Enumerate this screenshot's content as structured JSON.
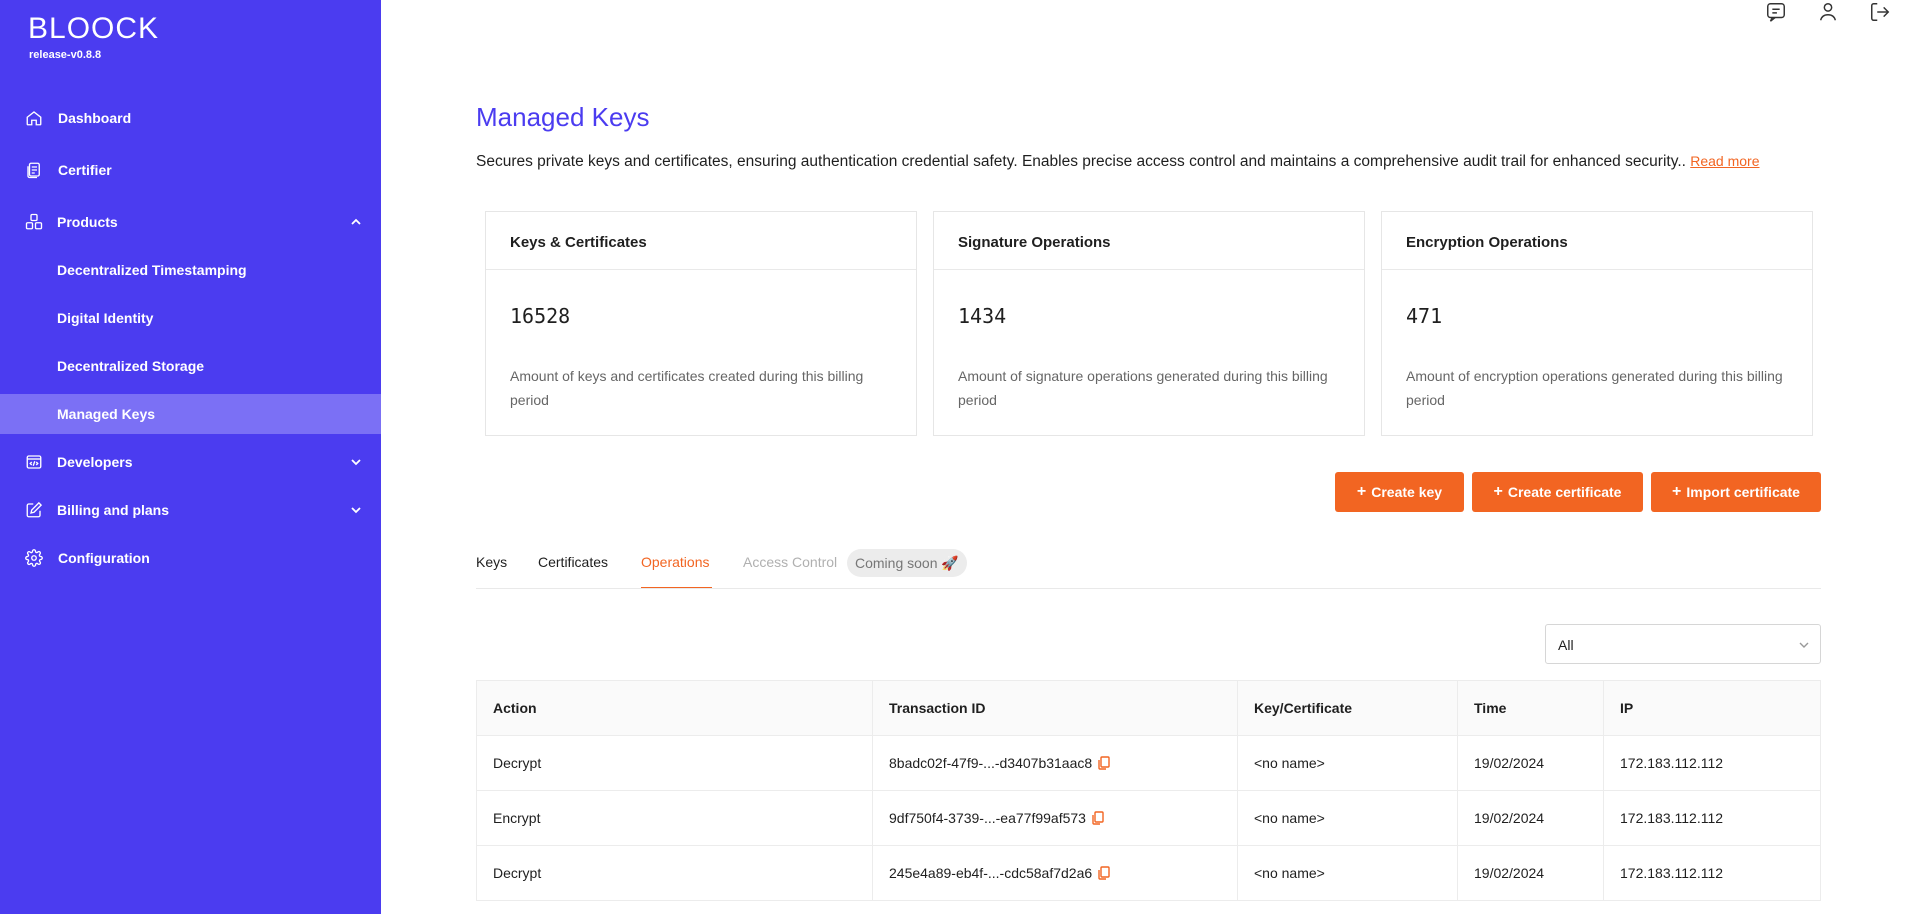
{
  "app": {
    "logo": "BLOOCK",
    "version": "release-v0.8.8"
  },
  "sidebar": {
    "items": [
      {
        "label": "Dashboard",
        "icon": "home-icon"
      },
      {
        "label": "Certifier",
        "icon": "document-icon"
      },
      {
        "label": "Products",
        "icon": "boxes-icon",
        "expanded": true
      },
      {
        "label": "Developers",
        "icon": "code-icon"
      },
      {
        "label": "Billing and plans",
        "icon": "edit-icon"
      },
      {
        "label": "Configuration",
        "icon": "gear-icon"
      }
    ],
    "sub_items": [
      {
        "label": "Decentralized Timestamping"
      },
      {
        "label": "Digital Identity"
      },
      {
        "label": "Decentralized Storage"
      },
      {
        "label": "Managed Keys",
        "active": true
      }
    ]
  },
  "header": {
    "icons": [
      "chat-icon",
      "user-icon",
      "logout-icon"
    ]
  },
  "main": {
    "title": "Managed Keys",
    "description": "Secures private keys and certificates, ensuring authentication credential safety. Enables precise access control and maintains a comprehensive audit trail for enhanced security..",
    "read_more": "Read more",
    "cards": [
      {
        "title": "Keys & Certificates",
        "value": "16528",
        "note": "Amount of keys and certificates created during this billing period"
      },
      {
        "title": "Signature Operations",
        "value": "1434",
        "note": "Amount of signature operations generated during this billing period"
      },
      {
        "title": "Encryption Operations",
        "value": "471",
        "note": "Amount of encryption operations generated during this billing period"
      }
    ],
    "buttons": {
      "create_key": "Create key",
      "create_certificate": "Create certificate",
      "import_certificate": "Import certificate"
    },
    "tabs": [
      {
        "label": "Keys"
      },
      {
        "label": "Certificates"
      },
      {
        "label": "Operations",
        "active": true
      },
      {
        "label": "Access Control",
        "disabled": true
      }
    ],
    "badge": "Coming soon 🚀",
    "filter": {
      "selected": "All"
    },
    "table": {
      "headers": [
        "Action",
        "Transaction ID",
        "Key/Certificate",
        "Time",
        "IP"
      ],
      "rows": [
        [
          "Decrypt",
          "8badc02f-47f9-...-d3407b31aac8",
          "<no name>",
          "19/02/2024",
          "172.183.112.112"
        ],
        [
          "Encrypt",
          "9df750f4-3739-...-ea77f99af573",
          "<no name>",
          "19/02/2024",
          "172.183.112.112"
        ],
        [
          "Decrypt",
          "245e4a89-eb4f-...-cdc58af7d2a6",
          "<no name>",
          "19/02/2024",
          "172.183.112.112"
        ]
      ]
    }
  },
  "colors": {
    "brand": "#4b3cf0",
    "sidebar_active": "#7b70f5",
    "accent": "#f26522"
  }
}
